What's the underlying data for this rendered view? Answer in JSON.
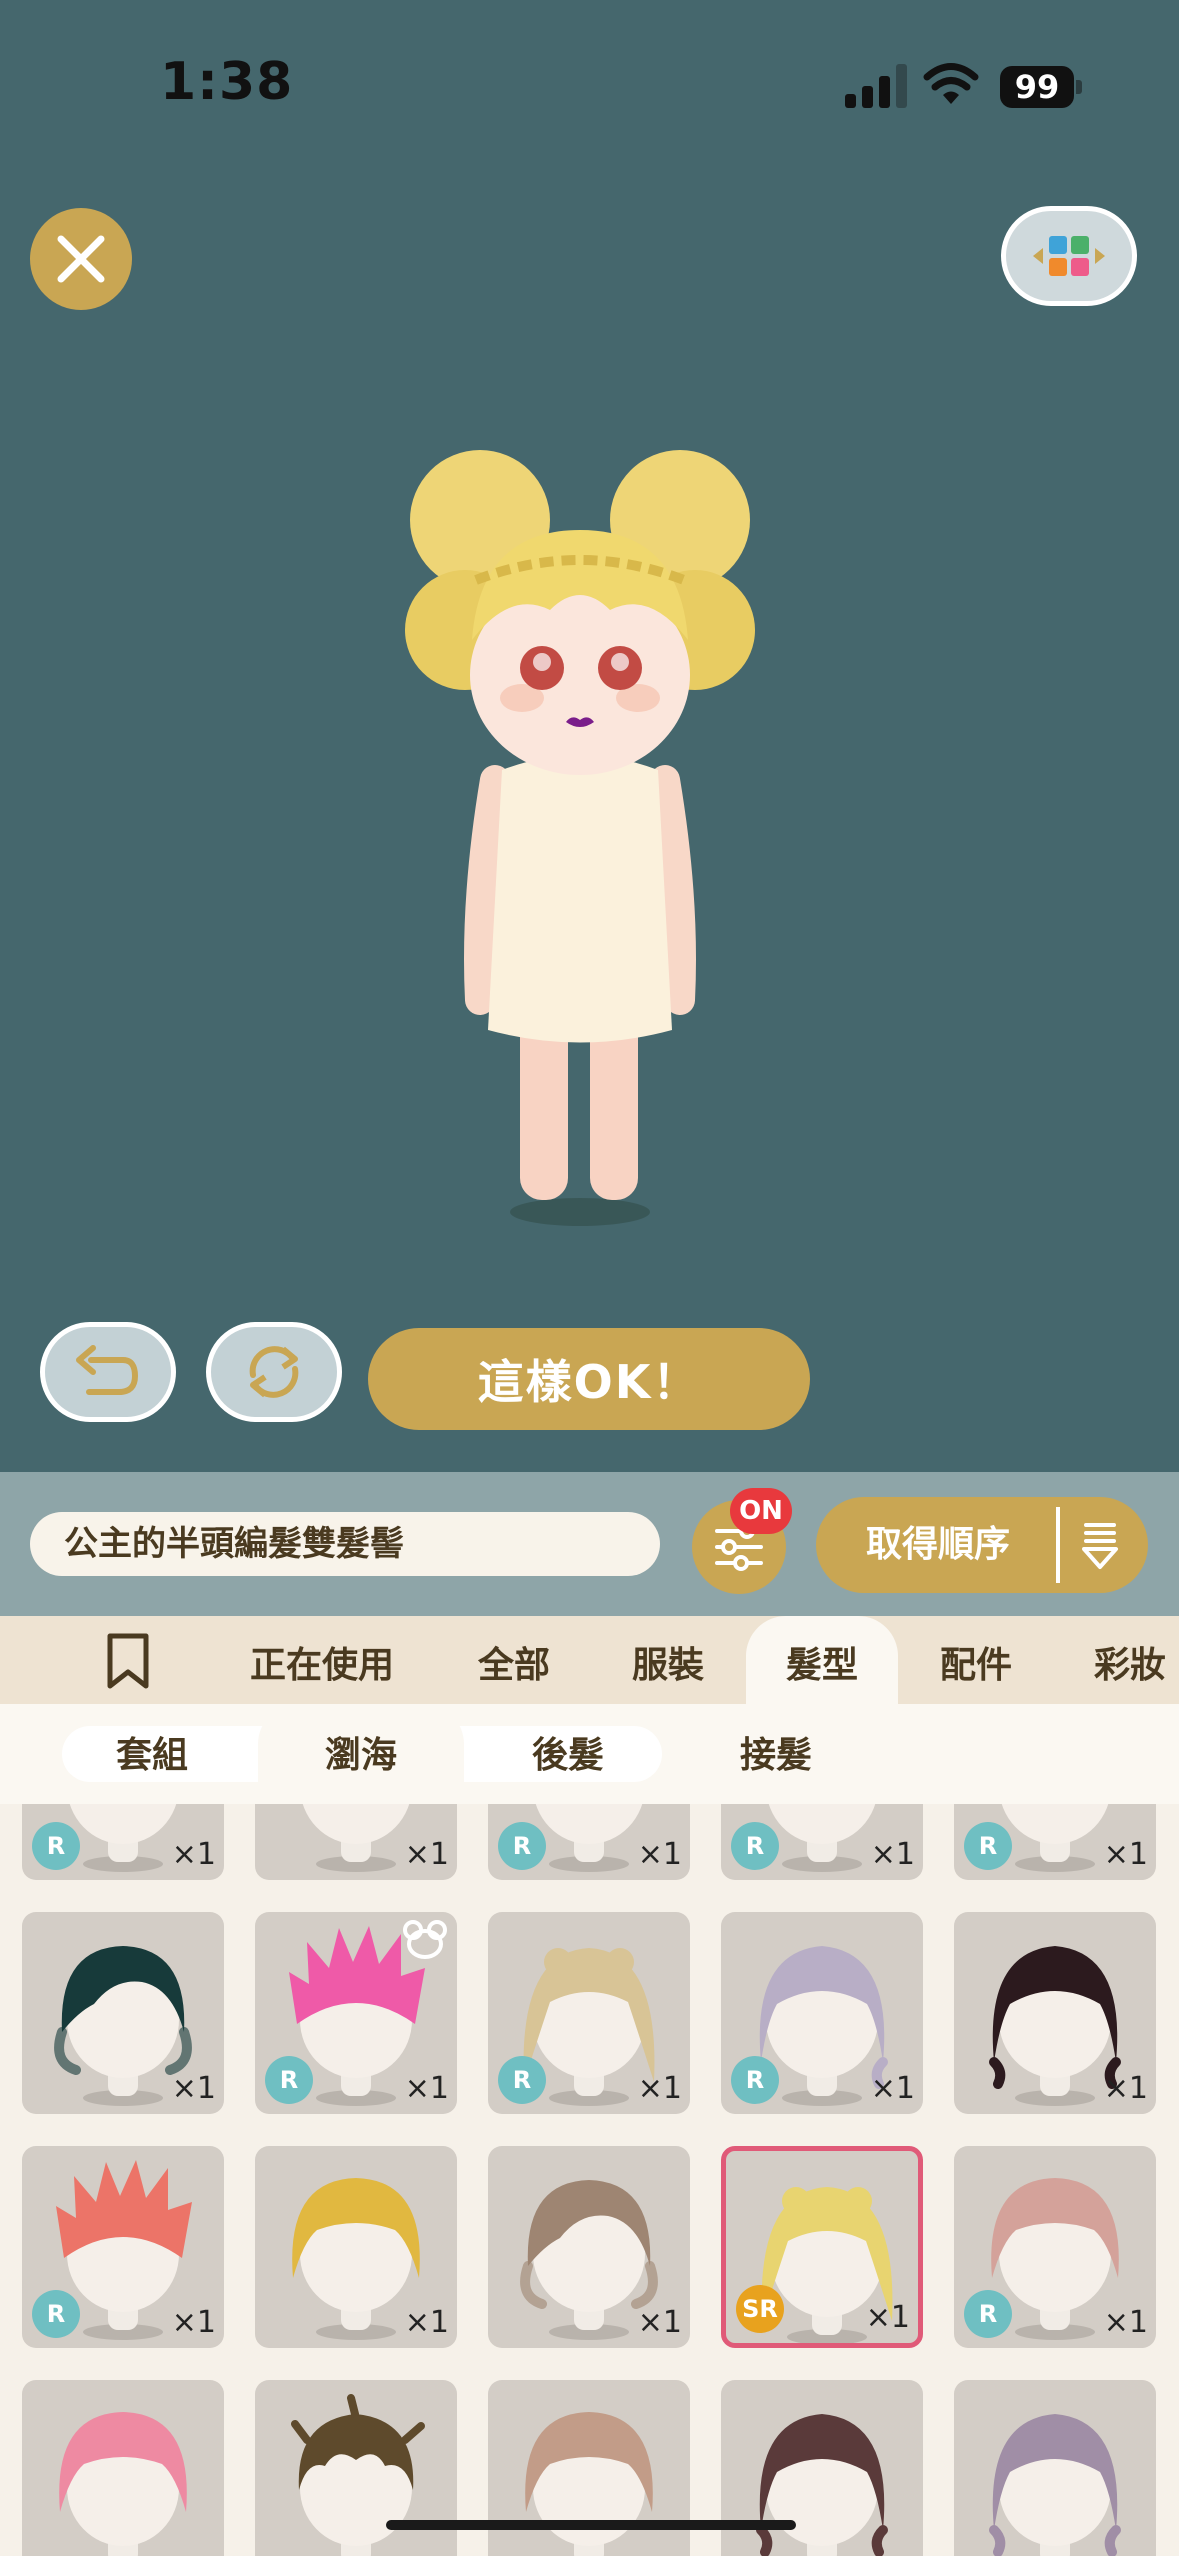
{
  "status": {
    "time": "1:38",
    "battery": "99"
  },
  "buttons": {
    "ok": "這樣OK！",
    "order": "取得順序",
    "filter_badge": "ON"
  },
  "current_item_name": "公主的半頭編髮雙髮髻",
  "categories": [
    "正在使用",
    "全部",
    "服裝",
    "髮型",
    "配件",
    "彩妝"
  ],
  "active_category": "髮型",
  "subcategories": [
    "套組",
    "瀏海",
    "後髮",
    "接髮"
  ],
  "active_subcategory": "瀏海",
  "colors": {
    "background": "#45676d",
    "gold": "#c9a653",
    "selected_border": "#e05a78"
  },
  "grid": [
    {
      "hair": "#f4efe9",
      "style": "bun",
      "rarity": "R",
      "count": "×1"
    },
    {
      "hair": "#3a332c",
      "style": "messy",
      "rarity": "",
      "count": "×1"
    },
    {
      "hair": "#e8d6a4",
      "style": "messy",
      "rarity": "R",
      "count": "×1"
    },
    {
      "hair": "#7fa2a8",
      "style": "messy",
      "rarity": "R",
      "count": "×1"
    },
    {
      "hair": "#e83fd0",
      "style": "bun",
      "rarity": "R",
      "count": "×1"
    },
    {
      "hair": "#173a3a",
      "style": "slick",
      "rarity": "",
      "count": "×1"
    },
    {
      "hair": "#ef5aa8",
      "style": "spiky",
      "rarity": "R",
      "count": "×1",
      "badge": "bear"
    },
    {
      "hair": "#d8c496",
      "style": "long",
      "rarity": "R",
      "count": "×1"
    },
    {
      "hair": "#b8aec6",
      "style": "wavy",
      "rarity": "R",
      "count": "×1"
    },
    {
      "hair": "#2c1a1e",
      "style": "wavy",
      "rarity": "",
      "count": "×1"
    },
    {
      "hair": "#ec7468",
      "style": "spiky",
      "rarity": "R",
      "count": "×1"
    },
    {
      "hair": "#e1b840",
      "style": "bob",
      "rarity": "",
      "count": "×1"
    },
    {
      "hair": "#9e8572",
      "style": "slick",
      "rarity": "",
      "count": "×1"
    },
    {
      "hair": "#e8d470",
      "style": "long",
      "rarity": "SR",
      "count": "×1",
      "selected": true
    },
    {
      "hair": "#d4a29a",
      "style": "bob",
      "rarity": "R",
      "count": "×1"
    },
    {
      "hair": "#ee8aa2",
      "style": "bob",
      "rarity": "",
      "count": ""
    },
    {
      "hair": "#5e4a2c",
      "style": "messy",
      "rarity": "",
      "count": ""
    },
    {
      "hair": "#c29c88",
      "style": "bob",
      "rarity": "",
      "count": ""
    },
    {
      "hair": "#5a3a3a",
      "style": "wavy",
      "rarity": "",
      "count": ""
    },
    {
      "hair": "#a08ea6",
      "style": "wavy",
      "rarity": "",
      "count": ""
    }
  ]
}
